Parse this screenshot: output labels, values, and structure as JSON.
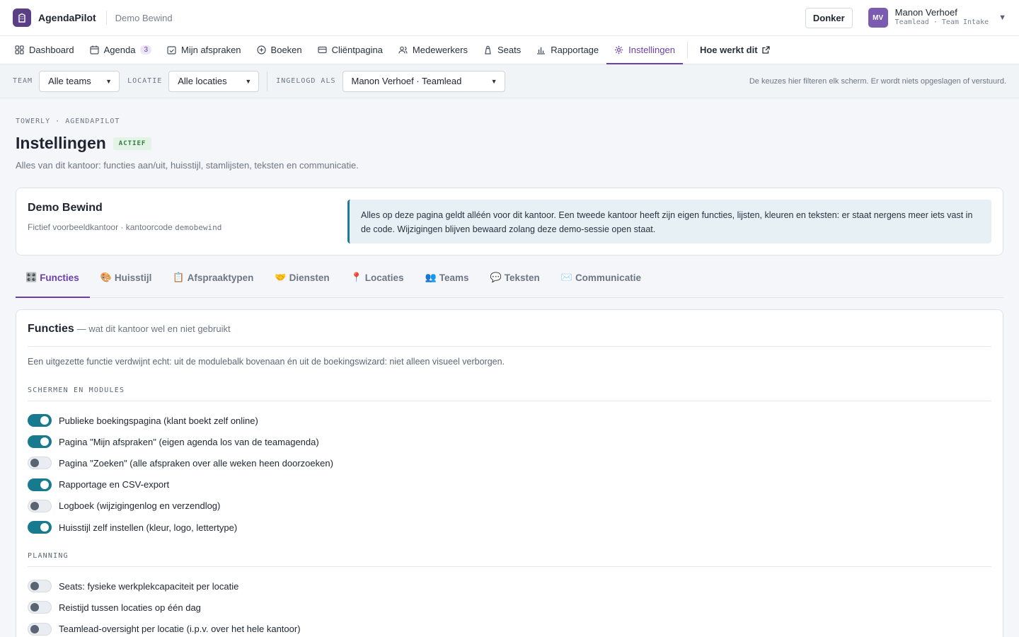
{
  "header": {
    "app_name": "AgendaPilot",
    "tenant": "Demo Bewind",
    "theme_button": "Donker",
    "user": {
      "initials": "MV",
      "name": "Manon Verhoef",
      "role": "Teamlead · Team Intake"
    }
  },
  "nav": {
    "items": [
      {
        "label": "Dashboard",
        "icon": "grid-icon"
      },
      {
        "label": "Agenda",
        "icon": "calendar-icon",
        "badge": "3"
      },
      {
        "label": "Mijn afspraken",
        "icon": "calendar-check-icon"
      },
      {
        "label": "Boeken",
        "icon": "plus-circle-icon"
      },
      {
        "label": "Cliëntpagina",
        "icon": "card-icon"
      },
      {
        "label": "Medewerkers",
        "icon": "users-icon"
      },
      {
        "label": "Seats",
        "icon": "lock-icon"
      },
      {
        "label": "Rapportage",
        "icon": "bar-chart-icon"
      },
      {
        "label": "Instellingen",
        "icon": "gear-icon",
        "active": true
      }
    ],
    "help": "Hoe werkt dit"
  },
  "filters": {
    "team_label": "TEAM",
    "team_value": "Alle teams",
    "location_label": "LOCATIE",
    "location_value": "Alle locaties",
    "login_label": "INGELOGD ALS",
    "login_value": "Manon Verhoef · Teamlead",
    "note": "De keuzes hier filteren elk scherm. Er wordt niets opgeslagen of verstuurd."
  },
  "page": {
    "eyebrow": "TOWERLY · AGENDAPILOT",
    "title": "Instellingen",
    "status": "ACTIEF",
    "subtitle": "Alles van dit kantoor: functies aan/uit, huisstijl, stamlijsten, teksten en communicatie."
  },
  "tenant_card": {
    "name": "Demo Bewind",
    "meta_prefix": "Fictief voorbeeldkantoor · kantoorcode ",
    "code": "demobewind",
    "notice": "Alles op deze pagina geldt alléén voor dit kantoor. Een tweede kantoor heeft zijn eigen functies, lijsten, kleuren en teksten: er staat nergens meer iets vast in de code. Wijzigingen blijven bewaard zolang deze demo-sessie open staat."
  },
  "tabs": [
    {
      "emoji": "🎛️",
      "label": "Functies",
      "active": true
    },
    {
      "emoji": "🎨",
      "label": "Huisstijl"
    },
    {
      "emoji": "📋",
      "label": "Afspraaktypen"
    },
    {
      "emoji": "🤝",
      "label": "Diensten"
    },
    {
      "emoji": "📍",
      "label": "Locaties"
    },
    {
      "emoji": "👥",
      "label": "Teams"
    },
    {
      "emoji": "💬",
      "label": "Teksten"
    },
    {
      "emoji": "✉️",
      "label": "Communicatie"
    }
  ],
  "section": {
    "title": "Functies",
    "subtitle": "— wat dit kantoor wel en niet gebruikt",
    "description": "Een uitgezette functie verdwijnt echt: uit de modulebalk bovenaan én uit de boekingswizard: niet alleen visueel verborgen.",
    "groups": [
      {
        "title": "SCHERMEN EN MODULES",
        "toggles": [
          {
            "label": "Publieke boekingspagina (klant boekt zelf online)",
            "on": true
          },
          {
            "label": "Pagina \"Mijn afspraken\" (eigen agenda los van de teamagenda)",
            "on": true
          },
          {
            "label": "Pagina \"Zoeken\" (alle afspraken over alle weken heen doorzoeken)",
            "on": false
          },
          {
            "label": "Rapportage en CSV-export",
            "on": true
          },
          {
            "label": "Logboek (wijzigingenlog en verzendlog)",
            "on": false
          },
          {
            "label": "Huisstijl zelf instellen (kleur, logo, lettertype)",
            "on": true
          }
        ]
      },
      {
        "title": "PLANNING",
        "toggles": [
          {
            "label": "Seats: fysieke werkplekcapaciteit per locatie",
            "on": false
          },
          {
            "label": "Reistijd tussen locaties op één dag",
            "on": false
          },
          {
            "label": "Teamlead-oversight per locatie (i.p.v. over het hele kantoor)",
            "on": false
          }
        ]
      }
    ]
  },
  "colors": {
    "accent": "#6b3fa8",
    "toggle_on": "#177a8f",
    "brand": "#5b3f86"
  }
}
